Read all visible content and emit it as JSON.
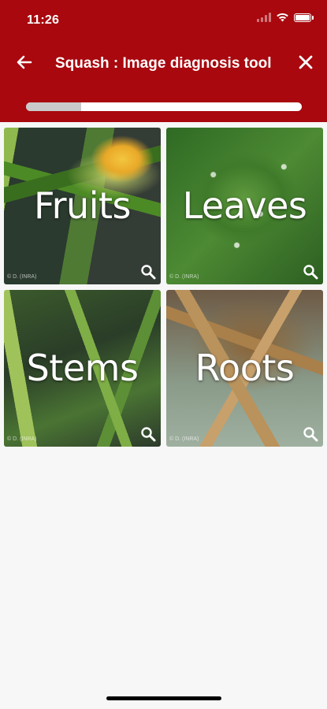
{
  "status_bar": {
    "time": "11:26",
    "icons": [
      "signal-icon",
      "wifi-icon",
      "battery-icon"
    ]
  },
  "header": {
    "title": "Squash : Image diagnosis tool",
    "back_icon": "arrow-left-icon",
    "close_icon": "close-icon",
    "progress": 0.2,
    "background_color": "#a8080e"
  },
  "categories": [
    {
      "label": "Fruits",
      "credit": "© D. (INRA)",
      "icon": "zoom-icon"
    },
    {
      "label": "Leaves",
      "credit": "© D. (INRA)",
      "icon": "zoom-icon"
    },
    {
      "label": "Stems",
      "credit": "© D. (INRA)",
      "icon": "zoom-icon"
    },
    {
      "label": "Roots",
      "credit": "© D. (INRA)",
      "icon": "zoom-icon"
    }
  ]
}
